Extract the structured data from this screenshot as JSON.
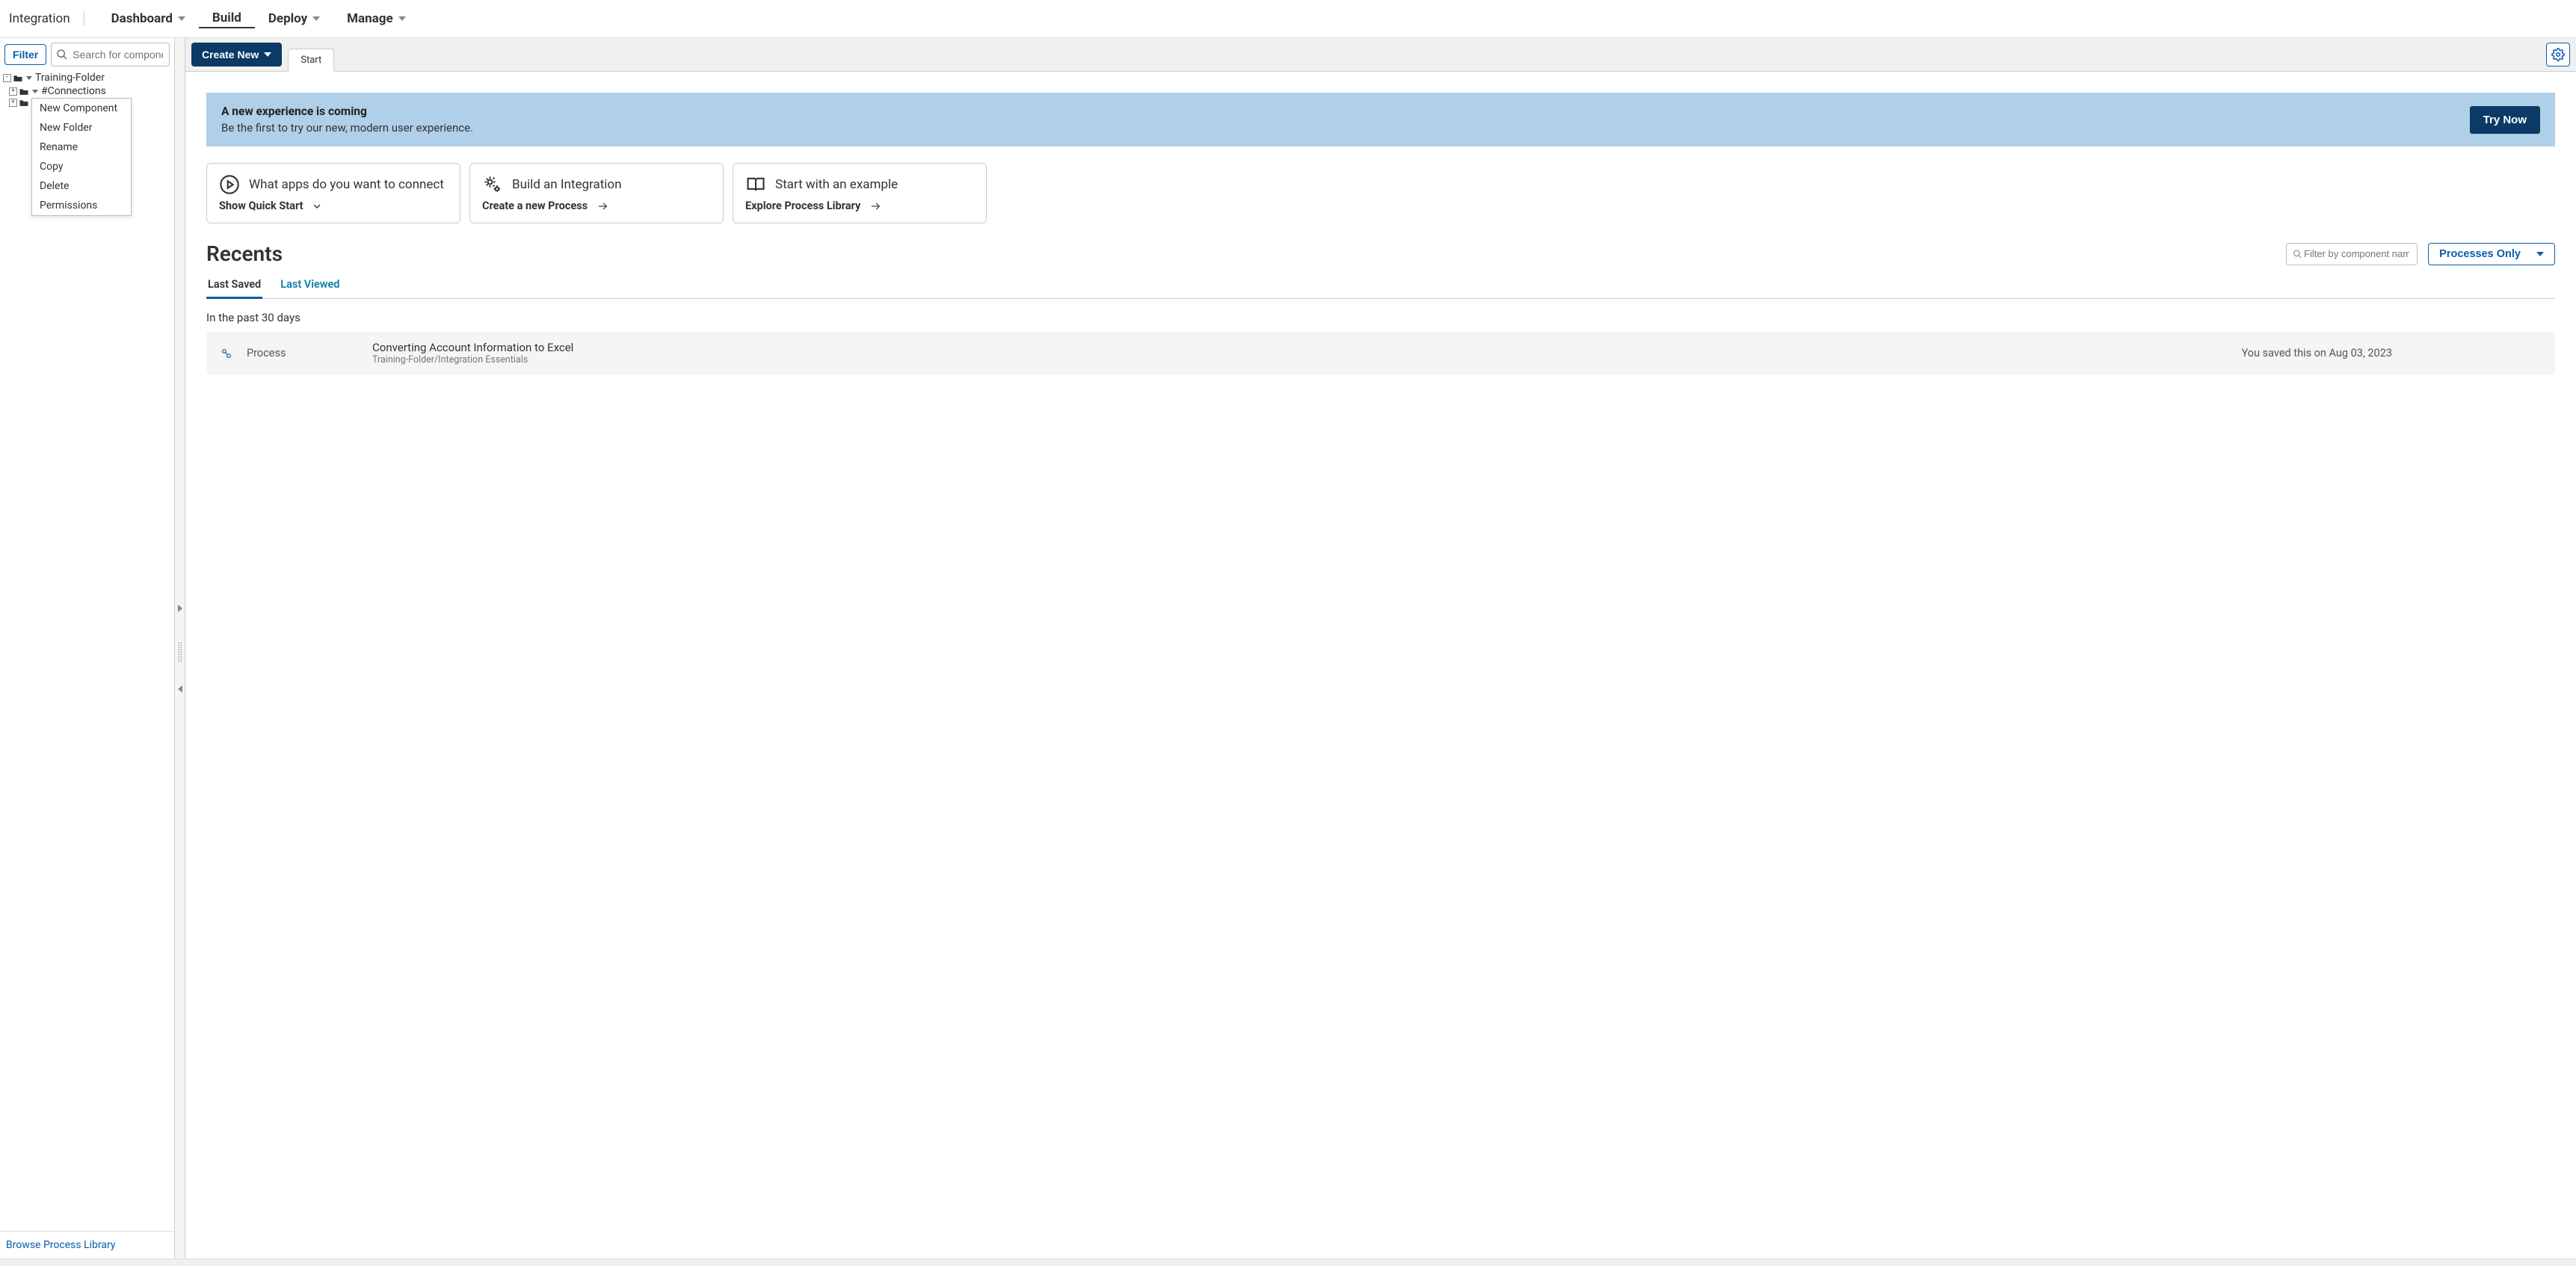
{
  "topnav": {
    "brand": "Integration",
    "items": [
      {
        "label": "Dashboard",
        "hasCaret": true,
        "active": false
      },
      {
        "label": "Build",
        "hasCaret": false,
        "active": true
      },
      {
        "label": "Deploy",
        "hasCaret": true,
        "active": false
      },
      {
        "label": "Manage",
        "hasCaret": true,
        "active": false
      }
    ]
  },
  "sidebar": {
    "filter_label": "Filter",
    "search_placeholder": "Search for component or",
    "tree": {
      "root": {
        "label": "Training-Folder"
      },
      "children": [
        {
          "label": "#Connections"
        },
        {
          "label": ""
        }
      ]
    },
    "context_menu": [
      "New Component",
      "New Folder",
      "Rename",
      "Copy",
      "Delete",
      "Permissions"
    ],
    "footer_link": "Browse Process Library"
  },
  "toolbar": {
    "create_label": "Create New",
    "tabs": [
      {
        "label": "Start"
      }
    ]
  },
  "banner": {
    "title": "A new experience is coming",
    "subtitle": "Be the first to try our new, modern user experience.",
    "cta": "Try Now"
  },
  "cards": [
    {
      "title": "What apps do you want to connect",
      "link": "Show Quick Start",
      "link_icon": "chevron-down"
    },
    {
      "title": "Build an Integration",
      "link": "Create a new Process",
      "link_icon": "arrow-right"
    },
    {
      "title": "Start with an example",
      "link": "Explore Process Library",
      "link_icon": "arrow-right"
    }
  ],
  "recents": {
    "title": "Recents",
    "filter_placeholder": "Filter by component name",
    "processes_label": "Processes Only",
    "tabs": [
      {
        "label": "Last Saved",
        "active": true
      },
      {
        "label": "Last Viewed",
        "active": false
      }
    ],
    "section_label": "In the past 30 days",
    "item": {
      "type": "Process",
      "name": "Converting Account Information to Excel",
      "path": "Training-Folder/Integration Essentials",
      "date": "You saved this on Aug 03, 2023"
    }
  }
}
